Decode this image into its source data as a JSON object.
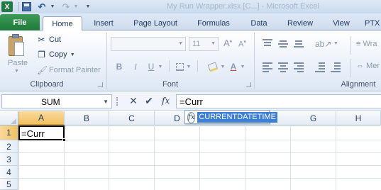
{
  "window": {
    "title": "My Run Wrapper.xlsx [C...] - Microsoft Excel"
  },
  "qat": {
    "icons": [
      "excel-logo-icon",
      "save-icon",
      "undo-icon",
      "redo-icon",
      "customize-qat-icon"
    ],
    "logo_letter": "X",
    "undo_glyph": "↶",
    "redo_glyph": "↷",
    "dropdown_glyph": "▼",
    "customize_glyph": "▼"
  },
  "tabs": [
    {
      "label": "File"
    },
    {
      "label": "Home"
    },
    {
      "label": "Insert"
    },
    {
      "label": "Page Layout"
    },
    {
      "label": "Formulas"
    },
    {
      "label": "Data"
    },
    {
      "label": "Review"
    },
    {
      "label": "View"
    },
    {
      "label": "PTX"
    }
  ],
  "ribbon": {
    "clipboard": {
      "paste_label": "Paste",
      "cut_label": "Cut",
      "copy_label": "Copy",
      "format_painter_label": "Format Painter",
      "group_label": "Clipboard"
    },
    "font": {
      "font_name": "",
      "font_size": "11",
      "bold_label": "B",
      "italic_label": "I",
      "underline_label": "U",
      "grow_label": "A",
      "shrink_label": "A",
      "group_label": "Font"
    },
    "alignment": {
      "wrap_label": "Wra",
      "merge_label": "Mer",
      "group_label": "Alignment"
    }
  },
  "formula_bar": {
    "name_box": "SUM",
    "cancel_glyph": "✕",
    "enter_glyph": "✔",
    "fx_label": "fx",
    "value": "=Curr"
  },
  "sheet": {
    "columns": [
      "A",
      "B",
      "C",
      "D",
      "E",
      "G",
      "H"
    ],
    "rows": [
      "1",
      "2",
      "3",
      "4",
      "5"
    ],
    "active_cell": {
      "ref": "A1",
      "text": "=Curr"
    }
  },
  "autocomplete": {
    "icon_label": "fx",
    "items": [
      "CURRENTDATETIME"
    ]
  },
  "colors": {
    "file_tab": "#1e7a3a",
    "selection_header": "#f1c15f",
    "autocomplete_highlight": "#3c7fd9"
  }
}
